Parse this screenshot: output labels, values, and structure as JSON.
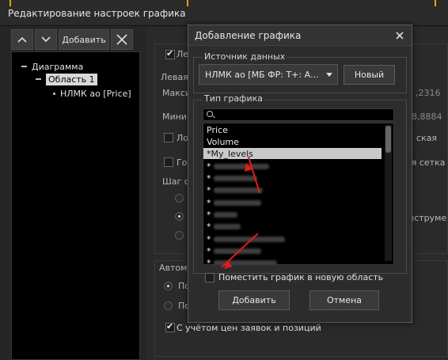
{
  "main_window": {
    "title": "Редактирование настроек графика"
  },
  "tree_toolbar": {
    "add_label": "Добавить"
  },
  "tree": {
    "root": "Диаграмма",
    "area": "Область 1",
    "series": "НЛМК ао [Price]"
  },
  "background": {
    "group_label_left": "Левая",
    "max_label": "Макси",
    "max_value": ",2316",
    "min_label": "Мини",
    "min_value": "8,8884",
    "cb1_label": "Ло",
    "cb1_right": "ская",
    "cb2_label": "Го",
    "cb2_right": "ая сетка",
    "step_label": "Шаг с",
    "instr_right": "нструме",
    "auto_label": "Автом",
    "radio1_label": "По",
    "radio2_label": "По",
    "orders_label": "С учётом цен заявок и позиций"
  },
  "dialog": {
    "title": "Добавление графика",
    "source_group": "Источник данных",
    "source_value": "НЛМК ао [МБ ФР: Т+: А...",
    "new_button": "Новый",
    "type_group": "Тип графика",
    "items": [
      "Price",
      "Volume",
      "*My_levels",
      "*",
      "*",
      "*",
      "*",
      "*",
      "*",
      "*",
      "*",
      "*"
    ],
    "new_area_label": "Поместить график в новую область",
    "add_button": "Добавить",
    "cancel_button": "Отмена"
  }
}
